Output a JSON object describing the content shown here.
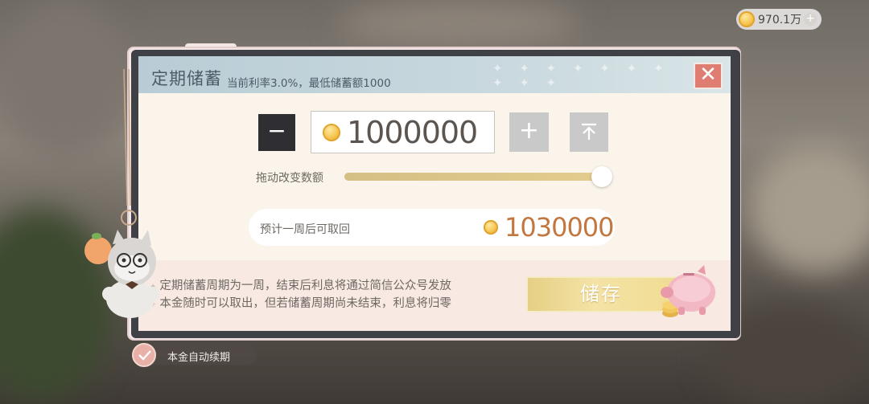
{
  "currency": {
    "amount": "970.1万",
    "coin_icon": "gold-coin-icon",
    "add_icon": "plus-icon"
  },
  "dialog": {
    "title": "定期储蓄",
    "subtitle": "当前利率3.0%，最低储蓄额1000",
    "close_icon": "close-icon"
  },
  "amount": {
    "decrease_icon": "minus-icon",
    "value": "1000000",
    "increase_icon": "plus-icon",
    "max_icon": "max-top-icon"
  },
  "slider": {
    "label": "拖动改变数额",
    "fraction": 1.0
  },
  "estimate": {
    "label": "预计一周后可取回",
    "value": "1030000"
  },
  "notes": [
    "定期储蓄周期为一周，结束后利息将通过简信公众号发放",
    "本金随时可以取出，但若储蓄周期尚未结束，利息将归零"
  ],
  "save_button": {
    "label": "储存"
  },
  "auto_renew": {
    "label": "本金自动续期",
    "checked": true
  },
  "colors": {
    "header": "#b9ccd5",
    "close": "#e07d72",
    "estimate_value": "#c1773f",
    "save": "#e6cf84",
    "slider_fill": "#d4bf85"
  }
}
